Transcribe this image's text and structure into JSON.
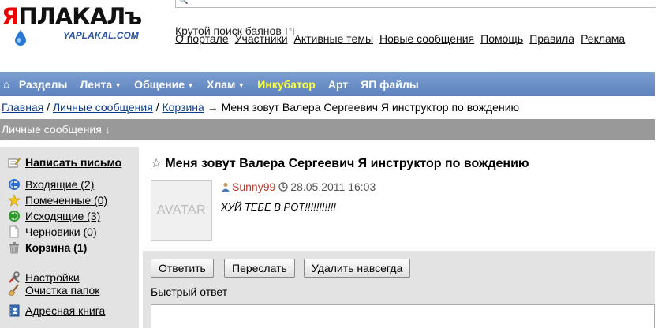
{
  "header": {
    "logo_text_accent": "Я",
    "logo_text_main": "ПЛАКАЛъ",
    "logo_sub": "YAPLAKAL.COM",
    "tagline": "Крутой поиск баянов",
    "tagline_help": "?",
    "top_links": [
      "О портале",
      "Участники",
      "Активные темы",
      "Новые сообщения",
      "Помощь",
      "Правила",
      "Реклама"
    ]
  },
  "nav": {
    "items": [
      {
        "label": "Разделы",
        "dropdown": false
      },
      {
        "label": "Лента",
        "dropdown": true
      },
      {
        "label": "Общение",
        "dropdown": true
      },
      {
        "label": "Хлам",
        "dropdown": true
      },
      {
        "label": "Инкубатор",
        "dropdown": false,
        "highlight": true
      },
      {
        "label": "Арт",
        "dropdown": false
      },
      {
        "label": "ЯП файлы",
        "dropdown": false
      }
    ],
    "arrow": "▼"
  },
  "breadcrumb": {
    "links": [
      "Главная",
      "Личные сообщения",
      "Корзина"
    ],
    "sep": " / ",
    "arrow": " → ",
    "current": "Меня зовут Валера Сергеевич Я инструктор по вождению"
  },
  "section_bar": "Личные сообщения ↓",
  "sidebar": {
    "compose": "Написать письмо",
    "folders": [
      {
        "label": "Входящие (2)",
        "icon": "inbox-icon",
        "bold": false
      },
      {
        "label": "Помеченные (0)",
        "icon": "star-icon",
        "bold": false
      },
      {
        "label": "Исходящие (3)",
        "icon": "outbox-icon",
        "bold": false
      },
      {
        "label": "Черновики (0)",
        "icon": "draft-icon",
        "bold": false
      },
      {
        "label": "Корзина (1)",
        "icon": "trash-icon",
        "bold": true
      }
    ],
    "settings": "Настройки",
    "clean": "Очистка папок",
    "addressbook": "Адресная книга"
  },
  "message": {
    "title": "Меня зовут Валера Сергеевич Я инструктор по вождению",
    "avatar_placeholder": "AVATAR",
    "author": "Sunny99",
    "date": "28.05.2011 16:03",
    "body": "ХУЙ ТЕБЕ В РОТ!!!!!!!!!!!"
  },
  "actions": {
    "reply": "Ответить",
    "forward": "Переслать",
    "delete": "Удалить навсегда",
    "quick_reply": "Быстрый ответ"
  },
  "colors": {
    "nav_bg": "#6b8ec8",
    "nav_highlight": "#ffff33",
    "logo_red": "#ee0000",
    "link_blue": "#0b3a8c",
    "author_red": "#c0392b",
    "panel_gray": "#e3e3e3"
  }
}
